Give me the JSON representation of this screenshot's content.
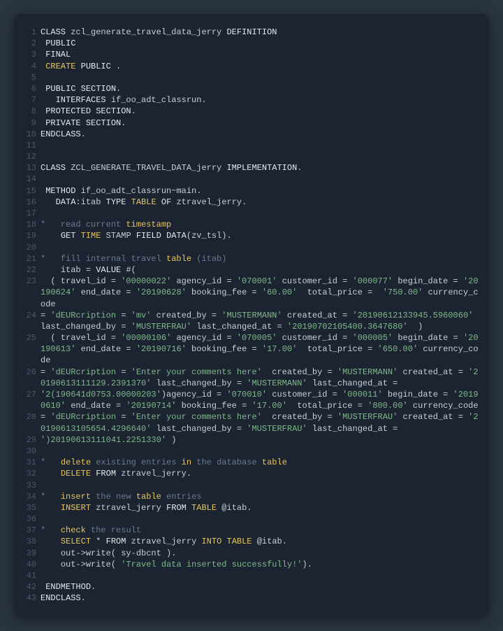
{
  "lines": [
    {
      "n": 1,
      "seg": [
        {
          "c": "kw",
          "t": "CLASS"
        },
        {
          "c": "",
          "t": " zcl_generate_travel_data_jerry "
        },
        {
          "c": "kw",
          "t": "DEFINITION"
        }
      ]
    },
    {
      "n": 2,
      "seg": [
        {
          "c": "",
          "t": " "
        },
        {
          "c": "kw",
          "t": "PUBLIC"
        }
      ]
    },
    {
      "n": 3,
      "seg": [
        {
          "c": "",
          "t": " "
        },
        {
          "c": "kw",
          "t": "FINAL"
        }
      ]
    },
    {
      "n": 4,
      "seg": [
        {
          "c": "",
          "t": " "
        },
        {
          "c": "yel",
          "t": "CREATE"
        },
        {
          "c": "",
          "t": " "
        },
        {
          "c": "kw",
          "t": "PUBLIC"
        },
        {
          "c": "",
          "t": " ."
        }
      ]
    },
    {
      "n": 5,
      "seg": [
        {
          "c": "",
          "t": ""
        }
      ]
    },
    {
      "n": 6,
      "seg": [
        {
          "c": "",
          "t": " "
        },
        {
          "c": "kw",
          "t": "PUBLIC SECTION"
        },
        {
          "c": "",
          "t": "."
        }
      ]
    },
    {
      "n": 7,
      "seg": [
        {
          "c": "",
          "t": "   "
        },
        {
          "c": "kw",
          "t": "INTERFACES"
        },
        {
          "c": "",
          "t": " if_oo_adt_classrun."
        }
      ]
    },
    {
      "n": 8,
      "seg": [
        {
          "c": "",
          "t": " "
        },
        {
          "c": "kw",
          "t": "PROTECTED SECTION"
        },
        {
          "c": "",
          "t": "."
        }
      ]
    },
    {
      "n": 9,
      "seg": [
        {
          "c": "",
          "t": " "
        },
        {
          "c": "kw",
          "t": "PRIVATE SECTION"
        },
        {
          "c": "",
          "t": "."
        }
      ]
    },
    {
      "n": 10,
      "seg": [
        {
          "c": "kw",
          "t": "ENDCLASS"
        },
        {
          "c": "",
          "t": "."
        }
      ]
    },
    {
      "n": 11,
      "seg": [
        {
          "c": "",
          "t": ""
        }
      ]
    },
    {
      "n": 12,
      "seg": [
        {
          "c": "",
          "t": ""
        }
      ]
    },
    {
      "n": 13,
      "seg": [
        {
          "c": "kw",
          "t": "CLASS"
        },
        {
          "c": "",
          "t": " ZCL_GENERATE_TRAVEL_DATA_jerry "
        },
        {
          "c": "kw",
          "t": "IMPLEMENTATION"
        },
        {
          "c": "",
          "t": "."
        }
      ]
    },
    {
      "n": 14,
      "seg": [
        {
          "c": "",
          "t": ""
        }
      ]
    },
    {
      "n": 15,
      "seg": [
        {
          "c": "",
          "t": " "
        },
        {
          "c": "kw",
          "t": "METHOD"
        },
        {
          "c": "",
          "t": " if_oo_adt_classrun~main."
        }
      ]
    },
    {
      "n": 16,
      "seg": [
        {
          "c": "",
          "t": "   "
        },
        {
          "c": "kw",
          "t": "DATA"
        },
        {
          "c": "",
          "t": ":itab "
        },
        {
          "c": "kw",
          "t": "TYPE"
        },
        {
          "c": "",
          "t": " "
        },
        {
          "c": "yel",
          "t": "TABLE"
        },
        {
          "c": "",
          "t": " "
        },
        {
          "c": "kw",
          "t": "OF"
        },
        {
          "c": "",
          "t": " ztravel_jerry."
        }
      ]
    },
    {
      "n": 17,
      "seg": [
        {
          "c": "",
          "t": ""
        }
      ]
    },
    {
      "n": 18,
      "seg": [
        {
          "c": "cmt",
          "t": "*   read current "
        },
        {
          "c": "yel",
          "t": "timestamp"
        }
      ]
    },
    {
      "n": 19,
      "seg": [
        {
          "c": "",
          "t": "    "
        },
        {
          "c": "kw",
          "t": "GET"
        },
        {
          "c": "",
          "t": " "
        },
        {
          "c": "yel",
          "t": "TIME"
        },
        {
          "c": "",
          "t": " STAMP "
        },
        {
          "c": "kw",
          "t": "FIELD"
        },
        {
          "c": "",
          "t": " "
        },
        {
          "c": "kw",
          "t": "DATA"
        },
        {
          "c": "",
          "t": "(zv_tsl)."
        }
      ]
    },
    {
      "n": 20,
      "seg": [
        {
          "c": "",
          "t": ""
        }
      ]
    },
    {
      "n": 21,
      "seg": [
        {
          "c": "cmt",
          "t": "*   fill internal travel "
        },
        {
          "c": "yel",
          "t": "table"
        },
        {
          "c": "cmt",
          "t": " (itab)"
        }
      ]
    },
    {
      "n": 22,
      "seg": [
        {
          "c": "",
          "t": "    itab = "
        },
        {
          "c": "kw",
          "t": "VALUE"
        },
        {
          "c": "",
          "t": " #("
        }
      ]
    },
    {
      "n": 23,
      "seg": [
        {
          "c": "",
          "t": "  ( travel_id = "
        },
        {
          "c": "str",
          "t": "'00000022'"
        },
        {
          "c": "",
          "t": " agency_id = "
        },
        {
          "c": "str",
          "t": "'070001'"
        },
        {
          "c": "",
          "t": " customer_id = "
        },
        {
          "c": "str",
          "t": "'000077'"
        },
        {
          "c": "",
          "t": " begin_date = "
        },
        {
          "c": "str",
          "t": "'20190624'"
        },
        {
          "c": "",
          "t": " end_date = "
        },
        {
          "c": "str",
          "t": "'20190628'"
        },
        {
          "c": "",
          "t": " booking_fee = "
        },
        {
          "c": "str",
          "t": "'60.00'"
        },
        {
          "c": "",
          "t": "  total_price = "
        },
        {
          "c": "str",
          "t": " '750.00'"
        },
        {
          "c": "",
          "t": " currency_code"
        }
      ]
    },
    {
      "n": 24,
      "seg": [
        {
          "c": "",
          "t": "= "
        },
        {
          "c": "str",
          "t": "'dEURcription"
        },
        {
          "c": "",
          "t": " = "
        },
        {
          "c": "str",
          "t": "'mv'"
        },
        {
          "c": "",
          "t": " created_by = "
        },
        {
          "c": "str",
          "t": "'MUSTERMANN'"
        },
        {
          "c": "",
          "t": " created_at = "
        },
        {
          "c": "str",
          "t": "'20190612133945.5960060'"
        },
        {
          "c": "",
          "t": " last_changed_by = "
        },
        {
          "c": "str",
          "t": "'MUSTERFRAU'"
        },
        {
          "c": "",
          "t": " last_changed_at = "
        },
        {
          "c": "str",
          "t": "'20190702105400.3647680'"
        },
        {
          "c": "",
          "t": "  )"
        }
      ]
    },
    {
      "n": 25,
      "seg": [
        {
          "c": "",
          "t": "  ( travel_id = "
        },
        {
          "c": "str",
          "t": "'00000106'"
        },
        {
          "c": "",
          "t": " agency_id = "
        },
        {
          "c": "str",
          "t": "'070005'"
        },
        {
          "c": "",
          "t": " customer_id = "
        },
        {
          "c": "str",
          "t": "'000005'"
        },
        {
          "c": "",
          "t": " begin_date = "
        },
        {
          "c": "str",
          "t": "'20190613'"
        },
        {
          "c": "",
          "t": " end_date = "
        },
        {
          "c": "str",
          "t": "'20190716'"
        },
        {
          "c": "",
          "t": " booking_fee = "
        },
        {
          "c": "str",
          "t": "'17.00'"
        },
        {
          "c": "",
          "t": "  total_price = "
        },
        {
          "c": "str",
          "t": "'650.00'"
        },
        {
          "c": "",
          "t": " currency_code"
        }
      ]
    },
    {
      "n": 26,
      "seg": [
        {
          "c": "",
          "t": "= "
        },
        {
          "c": "str",
          "t": "'dEURcription"
        },
        {
          "c": "",
          "t": " = "
        },
        {
          "c": "str",
          "t": "'Enter your comments here'"
        },
        {
          "c": "",
          "t": "  created_by = "
        },
        {
          "c": "str",
          "t": "'MUSTERMANN'"
        },
        {
          "c": "",
          "t": " created_at = "
        },
        {
          "c": "str",
          "t": "'20190613111129.2391370'"
        },
        {
          "c": "",
          "t": " last_changed_by = "
        },
        {
          "c": "str",
          "t": "'MUSTERMANN'"
        },
        {
          "c": "",
          "t": " last_changed_at ="
        }
      ]
    },
    {
      "n": 27,
      "seg": [
        {
          "c": "str",
          "t": "'2(190641d0753.00000203'"
        },
        {
          "c": "",
          "t": ")agency_id = "
        },
        {
          "c": "str",
          "t": "'070010'"
        },
        {
          "c": "",
          "t": " customer_id = "
        },
        {
          "c": "str",
          "t": "'000011'"
        },
        {
          "c": "",
          "t": " begin_date = "
        },
        {
          "c": "str",
          "t": "'20190610'"
        },
        {
          "c": "",
          "t": " end_date = "
        },
        {
          "c": "str",
          "t": "'20190714'"
        },
        {
          "c": "",
          "t": " booking_fee = "
        },
        {
          "c": "str",
          "t": "'17.00'"
        },
        {
          "c": "",
          "t": "  total_price = "
        },
        {
          "c": "str",
          "t": "'800.00'"
        },
        {
          "c": "",
          "t": " currency_code"
        }
      ]
    },
    {
      "n": 28,
      "seg": [
        {
          "c": "",
          "t": "= "
        },
        {
          "c": "str",
          "t": "'dEURcription"
        },
        {
          "c": "",
          "t": " = "
        },
        {
          "c": "str",
          "t": "'Enter your comments here'"
        },
        {
          "c": "",
          "t": "  created_by = "
        },
        {
          "c": "str",
          "t": "'MUSTERFRAU'"
        },
        {
          "c": "",
          "t": " created_at = "
        },
        {
          "c": "str",
          "t": "'20190613105654.4296640'"
        },
        {
          "c": "",
          "t": " last_changed_by = "
        },
        {
          "c": "str",
          "t": "'MUSTERFRAU'"
        },
        {
          "c": "",
          "t": " last_changed_at ="
        }
      ]
    },
    {
      "n": 29,
      "seg": [
        {
          "c": "str",
          "t": "')20190613111041.2251330'"
        },
        {
          "c": "",
          "t": " )"
        }
      ]
    },
    {
      "n": 30,
      "seg": [
        {
          "c": "",
          "t": ""
        }
      ]
    },
    {
      "n": 31,
      "seg": [
        {
          "c": "cmt",
          "t": "*   "
        },
        {
          "c": "yel",
          "t": "delete"
        },
        {
          "c": "cmt",
          "t": " existing entries "
        },
        {
          "c": "yel",
          "t": "in"
        },
        {
          "c": "cmt",
          "t": " the database "
        },
        {
          "c": "yel",
          "t": "table"
        }
      ]
    },
    {
      "n": 32,
      "seg": [
        {
          "c": "",
          "t": "    "
        },
        {
          "c": "yel",
          "t": "DELETE"
        },
        {
          "c": "",
          "t": " "
        },
        {
          "c": "kw",
          "t": "FROM"
        },
        {
          "c": "",
          "t": " ztravel_jerry."
        }
      ]
    },
    {
      "n": 33,
      "seg": [
        {
          "c": "",
          "t": ""
        }
      ]
    },
    {
      "n": 34,
      "seg": [
        {
          "c": "cmt",
          "t": "*   "
        },
        {
          "c": "yel",
          "t": "insert"
        },
        {
          "c": "cmt",
          "t": " the new "
        },
        {
          "c": "yel",
          "t": "table"
        },
        {
          "c": "cmt",
          "t": " entries"
        }
      ]
    },
    {
      "n": 35,
      "seg": [
        {
          "c": "",
          "t": "    "
        },
        {
          "c": "yel",
          "t": "INSERT"
        },
        {
          "c": "",
          "t": " ztravel_jerry "
        },
        {
          "c": "kw",
          "t": "FROM"
        },
        {
          "c": "",
          "t": " "
        },
        {
          "c": "yel",
          "t": "TABLE"
        },
        {
          "c": "",
          "t": " @itab."
        }
      ]
    },
    {
      "n": 36,
      "seg": [
        {
          "c": "",
          "t": ""
        }
      ]
    },
    {
      "n": 37,
      "seg": [
        {
          "c": "cmt",
          "t": "*   "
        },
        {
          "c": "yel",
          "t": "check"
        },
        {
          "c": "cmt",
          "t": " the result"
        }
      ]
    },
    {
      "n": 38,
      "seg": [
        {
          "c": "",
          "t": "    "
        },
        {
          "c": "yel",
          "t": "SELECT"
        },
        {
          "c": "",
          "t": " * "
        },
        {
          "c": "kw",
          "t": "FROM"
        },
        {
          "c": "",
          "t": " ztravel_jerry "
        },
        {
          "c": "yel",
          "t": "INTO"
        },
        {
          "c": "",
          "t": " "
        },
        {
          "c": "yel",
          "t": "TABLE"
        },
        {
          "c": "",
          "t": " @itab."
        }
      ]
    },
    {
      "n": 39,
      "seg": [
        {
          "c": "",
          "t": "    out->write( sy-dbcnt )."
        }
      ]
    },
    {
      "n": 40,
      "seg": [
        {
          "c": "",
          "t": "    out->write( "
        },
        {
          "c": "str",
          "t": "'Travel data inserted successfully!'"
        },
        {
          "c": "",
          "t": ")."
        }
      ]
    },
    {
      "n": 41,
      "seg": [
        {
          "c": "",
          "t": ""
        }
      ]
    },
    {
      "n": 42,
      "seg": [
        {
          "c": "",
          "t": " "
        },
        {
          "c": "kw",
          "t": "ENDMETHOD"
        },
        {
          "c": "",
          "t": "."
        }
      ]
    },
    {
      "n": 43,
      "seg": [
        {
          "c": "kw",
          "t": "ENDCLASS"
        },
        {
          "c": "",
          "t": "."
        }
      ]
    }
  ]
}
